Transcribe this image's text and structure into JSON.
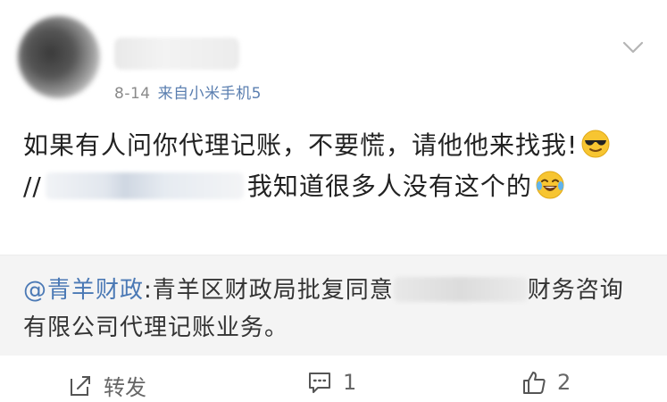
{
  "post": {
    "date": "8-14",
    "source": "来自小米手机5",
    "text_part1": "如果有人问你代理记账，不要慌，请他他来找我!",
    "text_part2": "//",
    "text_part3": "我知道很多人没有这个的"
  },
  "repost": {
    "mention": "@青羊财政",
    "text_before": ":青羊区财政局批复同意",
    "text_after": "财务咨询有限公司代理记账业务。"
  },
  "actions": {
    "repost_label": "转发",
    "comment_count": "1",
    "like_count": "2"
  },
  "icons": {
    "expand": "chevron-down-icon",
    "repost": "repost-icon",
    "comment": "comment-icon",
    "like": "thumbs-up-icon",
    "emoji1": "sunglasses-emoji-icon",
    "emoji2": "laughing-tears-emoji-icon"
  }
}
